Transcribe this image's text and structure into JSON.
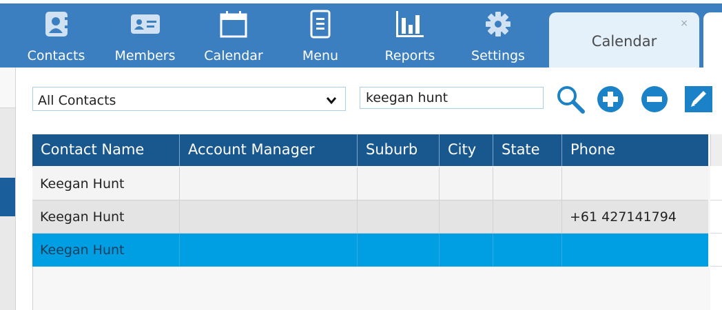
{
  "colors": {
    "toolbar": "#3b7fc0",
    "header": "#19588f",
    "selected_row": "#009fe3",
    "alt_row": "#e4e4e4",
    "icon_blue": "#1b82c8"
  },
  "toolbar": {
    "items": [
      {
        "label": "Contacts",
        "icon": "contact-card-icon"
      },
      {
        "label": "Members",
        "icon": "member-id-card-icon"
      },
      {
        "label": "Calendar",
        "icon": "calendar-icon"
      },
      {
        "label": "Menu",
        "icon": "document-menu-icon"
      },
      {
        "label": "Reports",
        "icon": "bar-chart-icon"
      },
      {
        "label": "Settings",
        "icon": "gear-icon"
      }
    ]
  },
  "tabs": [
    {
      "label": "Calendar",
      "close": "×",
      "active": true
    }
  ],
  "filter": {
    "selected": "All Contacts"
  },
  "search": {
    "value": "keegan hunt"
  },
  "actions": [
    "search-icon",
    "add-icon",
    "remove-icon",
    "edit-icon"
  ],
  "table": {
    "columns": [
      "Contact Name",
      "Account Manager",
      "Suburb",
      "City",
      "State",
      "Phone"
    ],
    "rows": [
      {
        "cells": [
          "Keegan Hunt",
          "",
          "",
          "",
          "",
          ""
        ],
        "selected": false
      },
      {
        "cells": [
          "Keegan Hunt",
          "",
          "",
          "",
          "",
          "+61 427141794"
        ],
        "selected": false
      },
      {
        "cells": [
          "Keegan Hunt",
          "",
          "",
          "",
          "",
          ""
        ],
        "selected": true
      }
    ]
  }
}
